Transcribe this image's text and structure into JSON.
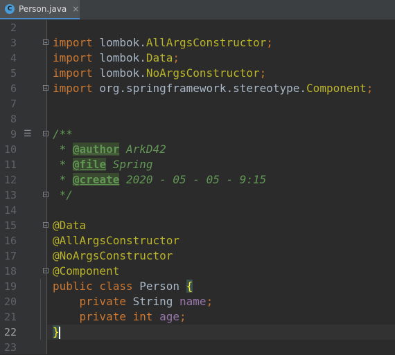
{
  "tab": {
    "label": "Person.java",
    "icon": "java-class-icon",
    "close": "×",
    "icon_letter": "C"
  },
  "editor": {
    "current_line": 22,
    "lines": [
      {
        "n": "2"
      },
      {
        "n": "3",
        "segs": [
          [
            "kw",
            "import"
          ],
          [
            "cls",
            " lombok."
          ],
          [
            "imp",
            "AllArgsConstructor"
          ],
          [
            "kw",
            ";"
          ]
        ],
        "fold": true
      },
      {
        "n": "4",
        "segs": [
          [
            "kw",
            "import"
          ],
          [
            "cls",
            " lombok."
          ],
          [
            "imp",
            "Data"
          ],
          [
            "kw",
            ";"
          ]
        ]
      },
      {
        "n": "5",
        "segs": [
          [
            "kw",
            "import"
          ],
          [
            "cls",
            " lombok."
          ],
          [
            "imp",
            "NoArgsConstructor"
          ],
          [
            "kw",
            ";"
          ]
        ]
      },
      {
        "n": "6",
        "segs": [
          [
            "kw",
            "import"
          ],
          [
            "cls",
            " org.springframework.stereotype."
          ],
          [
            "imp",
            "Component"
          ],
          [
            "kw",
            ";"
          ]
        ],
        "fold": true
      },
      {
        "n": "7"
      },
      {
        "n": "8"
      },
      {
        "n": "9",
        "segs": [
          [
            "doc",
            "/**"
          ]
        ],
        "fold": true,
        "docicon": true
      },
      {
        "n": "10",
        "segs": [
          [
            "doc",
            " * "
          ],
          [
            "tag",
            "@author"
          ],
          [
            "doc",
            " ArkD42"
          ]
        ]
      },
      {
        "n": "11",
        "segs": [
          [
            "doc",
            " * "
          ],
          [
            "tag",
            "@file"
          ],
          [
            "doc",
            " Spring"
          ]
        ]
      },
      {
        "n": "12",
        "segs": [
          [
            "doc",
            " * "
          ],
          [
            "tag",
            "@create"
          ],
          [
            "doc",
            " 2020 - 05 - 05 - 9:15"
          ]
        ]
      },
      {
        "n": "13",
        "segs": [
          [
            "doc",
            " */"
          ]
        ],
        "fold": true
      },
      {
        "n": "14"
      },
      {
        "n": "15",
        "segs": [
          [
            "ann",
            "@Data"
          ]
        ],
        "fold": true
      },
      {
        "n": "16",
        "segs": [
          [
            "ann",
            "@AllArgsConstructor"
          ]
        ]
      },
      {
        "n": "17",
        "segs": [
          [
            "ann",
            "@NoArgsConstructor"
          ]
        ]
      },
      {
        "n": "18",
        "segs": [
          [
            "ann",
            "@Component"
          ]
        ],
        "fold": true
      },
      {
        "n": "19",
        "segs": [
          [
            "kw",
            "public class "
          ],
          [
            "cls",
            "Person "
          ],
          [
            "brace",
            "{"
          ]
        ]
      },
      {
        "n": "20",
        "segs": [
          [
            "cls",
            "    "
          ],
          [
            "kw",
            "private "
          ],
          [
            "cls",
            "String "
          ],
          [
            "fld",
            "name"
          ],
          [
            "kw",
            ";"
          ]
        ]
      },
      {
        "n": "21",
        "segs": [
          [
            "cls",
            "    "
          ],
          [
            "kw",
            "private int "
          ],
          [
            "fld",
            "age"
          ],
          [
            "kw",
            ";"
          ]
        ]
      },
      {
        "n": "22",
        "segs": [
          [
            "brace",
            "}"
          ]
        ],
        "caret": true
      },
      {
        "n": "23"
      }
    ]
  }
}
